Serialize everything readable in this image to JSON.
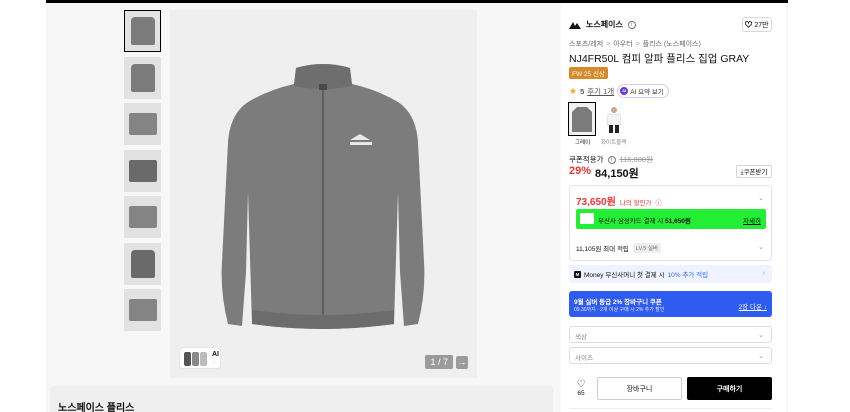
{
  "gallery": {
    "thumbnails": [
      "jacket-front",
      "jacket-back",
      "fabric-detail",
      "sleeve-detail",
      "logo-detail",
      "interior-view",
      "hem-detail"
    ],
    "pager": "1 / 7",
    "pager_next": "→",
    "ai_chip_label": "AI",
    "ai_chip_dot": "◦",
    "color": "#7b7b7b"
  },
  "description": {
    "heading": "노스페이스 플리스"
  },
  "product": {
    "brand": "노스페이스",
    "brand_info_icon": "i",
    "like_count": "27만",
    "breadcrumb": [
      "스포츠/레저",
      "아우터",
      "플리스 (노스페이스)"
    ],
    "breadcrumb_sep": ">",
    "title": "NJ4FR50L 컴피 알파 플리스 집업 GRAY",
    "season_badge": "FW 25 신상",
    "rating_star": "★",
    "rating": "5",
    "review_link": "후기 1개",
    "ai_summary_icon": "AI",
    "ai_summary": "AI 요약 보기",
    "swatches": [
      {
        "label": "그레이",
        "selected": true
      },
      {
        "label": "화이트블랙",
        "selected": false
      }
    ],
    "coupon_price_label": "쿠폰적용가",
    "coupon_info_icon": "i",
    "original_price": "116,000원",
    "discount_rate": "29%",
    "price": "84,150원",
    "coupon_button": "⤓쿠폰받기"
  },
  "benefits": {
    "my_discount_amount": "73,650원",
    "my_discount_label": "나의 할인가",
    "info_icon": "ⓘ",
    "chevron_down": "⌄",
    "chevron_right": "›",
    "card_promo_text_prefix": "무신사 삼성카드 결제 시",
    "card_promo_price": "51,650원",
    "card_promo_more": "자세히",
    "points_text": "11,105원 최대 적립",
    "points_tag": "LV.5 실버",
    "money_icon": "M",
    "money_text_prefix": "Money 무신사머니 첫 결제 시",
    "money_highlight": "10% 추가 적립",
    "coupon_banner_title": "9월 실버 등급 2% 장바구니 쿠폰",
    "coupon_banner_sub": "09.30까지 · 2개 이상 구매 시 2% 추가 할인",
    "coupon_banner_download": "2장 다운",
    "coupon_banner_download_arrow": "↓"
  },
  "options": {
    "color_placeholder": "색상",
    "size_placeholder": "사이즈"
  },
  "actions": {
    "heart_icon": "♡",
    "wish_count": "65",
    "cart_label": "장바구니",
    "buy_label": "구매하기"
  }
}
